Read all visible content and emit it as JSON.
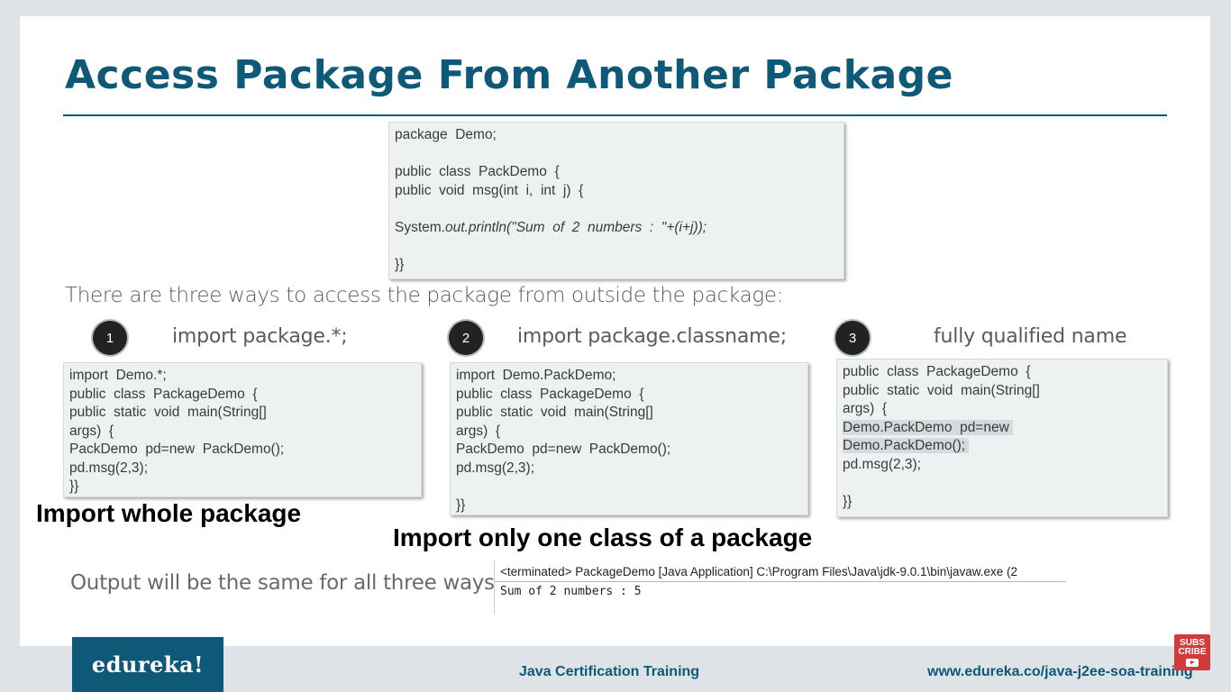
{
  "slide": {
    "title": "Access Package From Another Package",
    "package_code": [
      {
        "text": "package  Demo;"
      },
      {
        "text": ""
      },
      {
        "text": "public  class  PackDemo  {"
      },
      {
        "text": "public  void  msg(int  i,  int  j)  {"
      },
      {
        "text": ""
      },
      {
        "pre": "System.",
        "italic": "out.println(\"Sum  of  2  numbers  :  \"+(i+j));"
      },
      {
        "text": ""
      },
      {
        "text": "}}"
      }
    ],
    "subtitle": "There are three ways to access the package from outside the package:",
    "ways": [
      {
        "number": "1",
        "label": "import package.*;",
        "code": [
          {
            "text": "import  Demo.*;"
          },
          {
            "text": "public  class  PackageDemo  {"
          },
          {
            "text": "public  static  void  main(String[]"
          },
          {
            "text": "args)  {"
          },
          {
            "text": "PackDemo  pd=new  PackDemo();"
          },
          {
            "text": "pd.msg(2,3);"
          },
          {
            "text": "}}"
          }
        ]
      },
      {
        "number": "2",
        "label": "import package.classname;",
        "code": [
          {
            "text": "import  Demo.PackDemo;"
          },
          {
            "text": "public  class  PackageDemo  {"
          },
          {
            "text": "public  static  void  main(String[]"
          },
          {
            "text": "args)  {"
          },
          {
            "text": "PackDemo  pd=new  PackDemo();"
          },
          {
            "text": "pd.msg(2,3);"
          },
          {
            "text": ""
          },
          {
            "text": "}}"
          }
        ]
      },
      {
        "number": "3",
        "label": "fully qualified name",
        "code": [
          {
            "text": "public  class  PackageDemo  {"
          },
          {
            "text": "public  static  void  main(String[]"
          },
          {
            "text": "args)  {"
          },
          {
            "text": "Demo.PackDemo  pd=new ",
            "highlight": true
          },
          {
            "text": "Demo.PackDemo(); ",
            "highlight": true
          },
          {
            "text": "pd.msg(2,3);"
          },
          {
            "text": ""
          },
          {
            "text": "}}"
          }
        ]
      }
    ],
    "callout_whole": "Import whole package",
    "callout_one": "Import only one class of a package",
    "output_label": "Output will be the same for all three ways:",
    "console": {
      "header": "<terminated> PackageDemo [Java Application] C:\\Program Files\\Java\\jdk-9.0.1\\bin\\javaw.exe (2",
      "output": "Sum of 2 numbers : 5"
    }
  },
  "footer": {
    "logo": "edureka!",
    "course": "Java Certification Training",
    "url": "www.edureka.co/java-j2ee-soa-training",
    "subscribe_top": "SUBS",
    "subscribe_bottom": "CRIBE"
  },
  "colors": {
    "brand": "#0e5878",
    "code_bg": "#eef1f2",
    "subscribe": "#d23b3b"
  }
}
